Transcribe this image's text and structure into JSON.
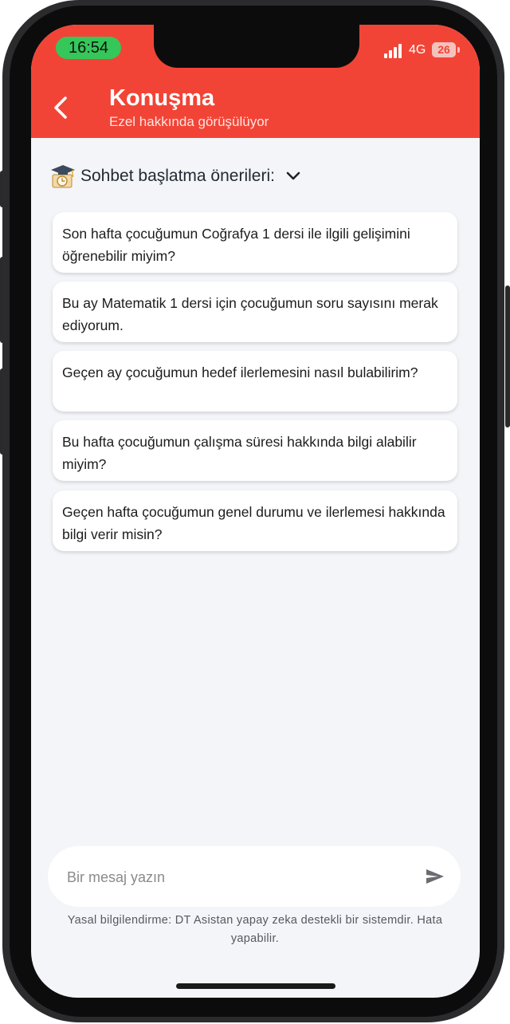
{
  "status_bar": {
    "time": "16:54",
    "network": "4G",
    "battery": "26",
    "colors": {
      "time_pill": "#35c759"
    }
  },
  "header": {
    "title": "Konuşma",
    "subtitle": "Ezel hakkında görüşülüyor",
    "back_icon": "chevron-left-icon",
    "colors": {
      "background": "#f24436"
    }
  },
  "suggestions": {
    "icon": "graduation-cap-clock-icon",
    "title": "Sohbet başlatma önerileri:",
    "toggle_icon": "chevron-down-icon",
    "items": [
      {
        "text": "Son hafta çocuğumun Coğrafya 1 dersi ile ilgili gelişimini öğrenebilir miyim?"
      },
      {
        "text": "Bu ay Matematik 1 dersi için çocuğumun soru sayısını merak ediyorum."
      },
      {
        "text": "Geçen ay çocuğumun hedef ilerlemesini nasıl bulabilirim?"
      },
      {
        "text": "Bu hafta çocuğumun çalışma süresi hakkında bilgi alabilir miyim?"
      },
      {
        "text": "Geçen hafta çocuğumun genel durumu ve ilerlemesi hakkında bilgi verir misin?"
      }
    ]
  },
  "composer": {
    "placeholder": "Bir mesaj yazın",
    "value": "",
    "send_icon": "send-icon"
  },
  "disclaimer": "Yasal bilgilendirme: DT Asistan yapay zeka destekli bir sistemdir. Hata yapabilir."
}
